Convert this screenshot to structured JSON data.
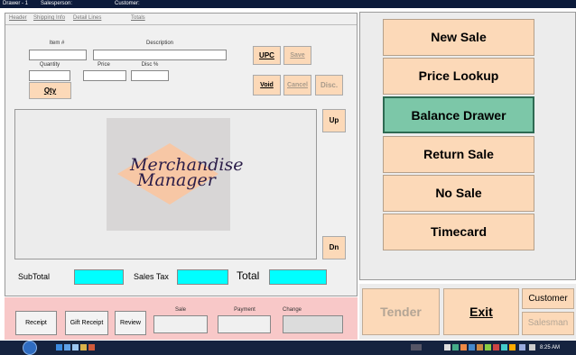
{
  "titlebar": {
    "drawer": "Drawer - 1",
    "salesperson_label": "Salesperson:",
    "customer_label": "Customer:"
  },
  "tabs": [
    "Header",
    "Shipping Info",
    "Detail Lines",
    "Totals"
  ],
  "item_form": {
    "item_label": "Item #",
    "description_label": "Description",
    "quantity_label": "Quantity",
    "price_label": "Price",
    "disc_label": "Disc %",
    "qty_button": "Qty"
  },
  "action_buttons": {
    "upc": "UPC",
    "save": "Save",
    "void": "Void",
    "cancel": "Cancel",
    "disc": "Disc.",
    "up": "Up",
    "dn": "Dn"
  },
  "logo": {
    "line1": "Merchandise",
    "line2": "Manager"
  },
  "totals": {
    "subtotal_label": "SubTotal",
    "sales_tax_label": "Sales Tax",
    "total_label": "Total"
  },
  "bottom_panel": {
    "receipt": "Receipt",
    "gift_receipt": "Gift Receipt",
    "review": "Review",
    "sale_label": "Sale",
    "payment_label": "Payment",
    "change_label": "Change"
  },
  "main_menu": [
    {
      "label": "New Sale",
      "selected": false
    },
    {
      "label": "Price Lookup",
      "selected": false
    },
    {
      "label": "Balance Drawer",
      "selected": true
    },
    {
      "label": "Return Sale",
      "selected": false
    },
    {
      "label": "No Sale",
      "selected": false
    },
    {
      "label": "Timecard",
      "selected": false
    }
  ],
  "bottom_right": {
    "tender": "Tender",
    "exit": "Exit",
    "customer": "Customer",
    "salesman": "Salesman"
  },
  "taskbar": {
    "clock": "8:25 AM"
  },
  "colors": {
    "peach": "#fcd9b8",
    "selected_green": "#7cc7a8",
    "cyan_field": "#00ffff",
    "pink_panel": "#f8c8c8"
  }
}
